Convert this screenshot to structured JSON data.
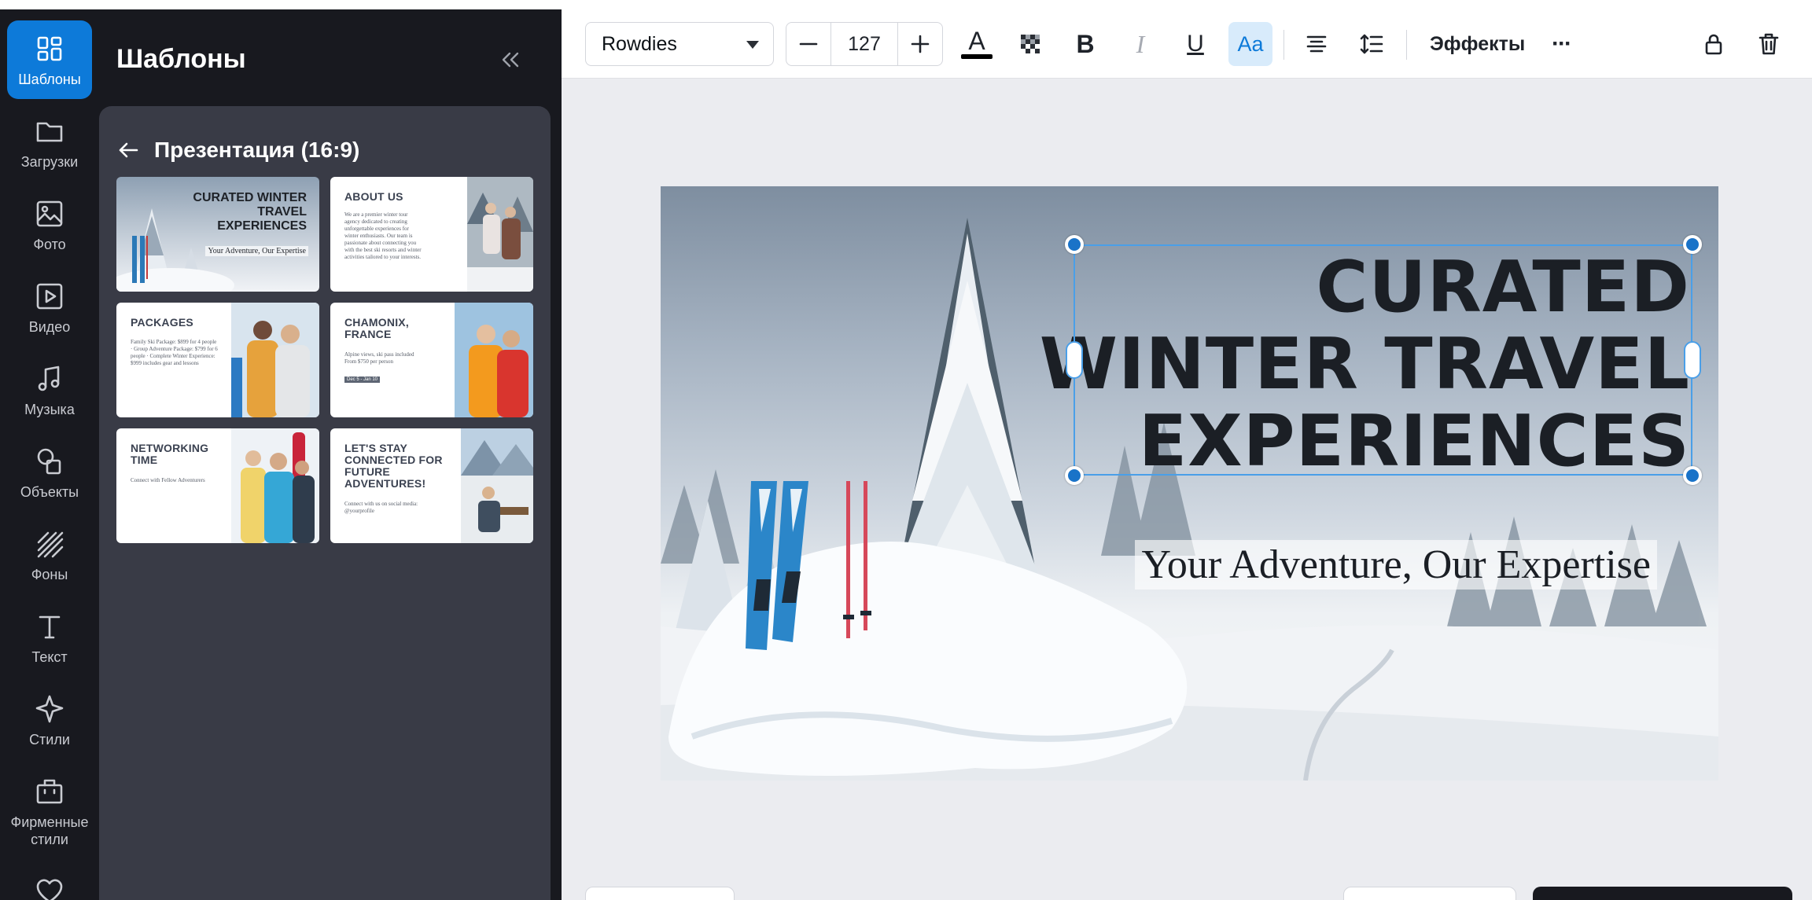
{
  "rail": {
    "items": [
      {
        "label": "Шаблоны",
        "icon": "templates-icon"
      },
      {
        "label": "Загрузки",
        "icon": "folder-icon"
      },
      {
        "label": "Фото",
        "icon": "photo-icon"
      },
      {
        "label": "Видео",
        "icon": "video-icon"
      },
      {
        "label": "Музыка",
        "icon": "music-icon"
      },
      {
        "label": "Объекты",
        "icon": "shapes-icon"
      },
      {
        "label": "Фоны",
        "icon": "backgrounds-icon"
      },
      {
        "label": "Текст",
        "icon": "text-icon"
      },
      {
        "label": "Стили",
        "icon": "sparkle-icon"
      },
      {
        "label": "Фирменные стили",
        "icon": "briefcase-icon"
      },
      {
        "label": "",
        "icon": "heart-icon"
      }
    ]
  },
  "panel": {
    "title": "Шаблоны",
    "back_label": "Презентация (16:9)",
    "templates": [
      {
        "title": "CURATED WINTER TRAVEL EXPERIENCES",
        "subtitle": "Your Adventure, Our Expertise"
      },
      {
        "title": "ABOUT US",
        "body": "We are a premier winter tour agency dedicated to creating unforgettable experiences for winter enthusiasts. Our team is passionate about connecting you with the best ski resorts and winter activities tailored to your interests."
      },
      {
        "title": "PACKAGES",
        "body": "Family Ski Package: $899 for 4 people · Group Adventure Package: $799 for 6 people · Complete Winter Experience: $999 includes gear and lessons"
      },
      {
        "title": "CHAMONIX, FRANCE",
        "body": "Alpine views, ski pass included From $750 per person",
        "tag": "Dec 5 - Jan 10"
      },
      {
        "title": "NETWORKING TIME",
        "body": "Connect with Fellow Adventurers"
      },
      {
        "title": "LET'S STAY CONNECTED FOR FUTURE ADVENTURES!",
        "body": "Connect with us on social media: @yourprofile"
      }
    ]
  },
  "toolbar": {
    "font_name": "Rowdies",
    "font_size": "127",
    "effects_label": "Эффекты",
    "bold_glyph": "B",
    "italic_glyph": "I",
    "underline_glyph": "U",
    "case_glyph": "Aa",
    "text_color_glyph": "A",
    "more_glyph": "···"
  },
  "slide": {
    "title_lines": [
      "CURATED",
      "WINTER TRAVEL",
      "EXPERIENCES"
    ],
    "subtitle": "Your Adventure, Our Expertise"
  },
  "colors": {
    "accent": "#0d7ad9",
    "sidebar_bg": "#18191f",
    "panel_card_bg": "#393b46",
    "canvas_bg": "#ebecf0",
    "selection": "#4a9fe8"
  }
}
